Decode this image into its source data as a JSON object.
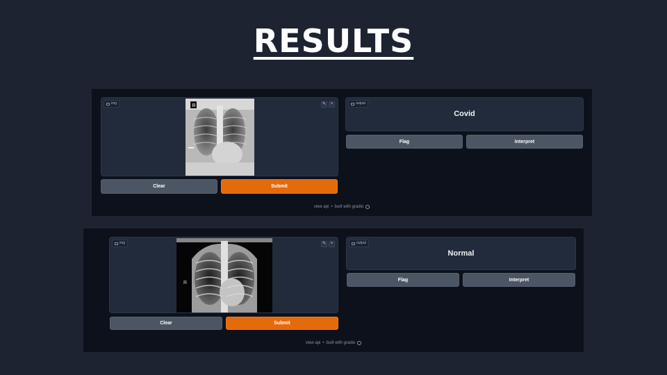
{
  "slide": {
    "title": "RESULTS"
  },
  "panels": [
    {
      "input_label": "img",
      "output_label": "output",
      "result": "Covid",
      "clear_label": "Clear",
      "submit_label": "Submit",
      "flag_label": "Flag",
      "interpret_label": "Interpret",
      "footer_api": "view api",
      "footer_sep": "•",
      "footer_built": "built with gradio",
      "xray_marker": "R"
    },
    {
      "input_label": "img",
      "output_label": "output",
      "result": "Normal",
      "clear_label": "Clear",
      "submit_label": "Submit",
      "flag_label": "Flag",
      "interpret_label": "Interpret",
      "footer_api": "view api",
      "footer_sep": "•",
      "footer_built": "built with gradio",
      "xray_marker": "R"
    }
  ],
  "icons": {
    "edit": "pencil-icon",
    "close": "close-icon",
    "image": "image-icon",
    "output": "output-icon",
    "logo": "gradio-logo-icon"
  },
  "colors": {
    "background": "#1d2330",
    "panel": "#0c111b",
    "box": "#212b3b",
    "button_gray": "#4b5563",
    "button_orange": "#e46a0c"
  }
}
